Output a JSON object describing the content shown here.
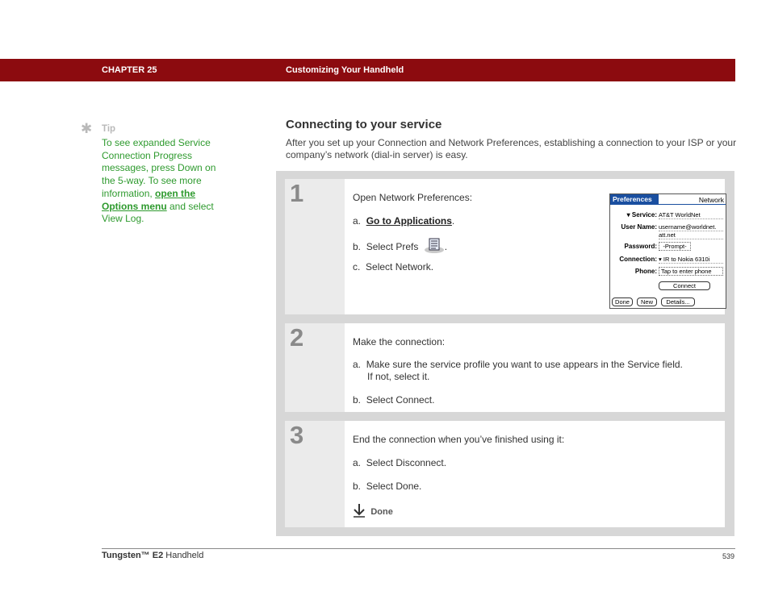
{
  "header": {
    "chapter": "CHAPTER 25",
    "title": "Customizing Your Handheld",
    "color": "#8c0b0f"
  },
  "tip": {
    "icon": "asterisk-icon",
    "label": "Tip",
    "text_before": "To see expanded Service Connection Progress messages, press Down on the 5-way. To see more information, ",
    "link": "open the Options menu",
    "text_after": " and select View Log.",
    "color": "#2e9a2e"
  },
  "section": {
    "title": "Connecting to your service",
    "intro": "After you set up your Connection and Network Preferences, establishing a connection to your ISP or your company’s network (dial-in server) is easy."
  },
  "steps": [
    {
      "number": "1",
      "lead": "Open Network Preferences:",
      "a_prefix": "a.",
      "a_link": "Go to Applications",
      "a_suffix": ".",
      "b_prefix": "b.",
      "b_text": "Select Prefs",
      "b_suffix": ".",
      "c_prefix": "c.",
      "c_text": "Select Network."
    },
    {
      "number": "2",
      "lead": "Make the connection:",
      "a_prefix": "a.",
      "a_text_1": "Make sure the service profile you want to use appears in the Service field.",
      "a_text_2": "If not, select it.",
      "b_prefix": "b.",
      "b_text": "Select Connect."
    },
    {
      "number": "3",
      "lead": "End the connection when you’ve finished using it:",
      "a_prefix": "a.",
      "a_text": "Select Disconnect.",
      "b_prefix": "b.",
      "b_text": "Select Done.",
      "done_icon": "down-arrow-icon",
      "done_label": "Done"
    }
  ],
  "palm_screen": {
    "tab": "Preferences",
    "app": "Network",
    "service_label": "Service:",
    "service_value": "AT&T WorldNet",
    "username_label": "User Name:",
    "username_value_1": "username@worldnet.",
    "username_value_2": "att.net",
    "password_label": "Password:",
    "password_value": "-Prompt-",
    "connection_label": "Connection:",
    "connection_value": "IR to Nokia 6310i",
    "phone_label": "Phone:",
    "phone_value": "Tap to enter phone",
    "connect_button": "Connect",
    "done_button": "Done",
    "new_button": "New",
    "details_button": "Details..."
  },
  "footer": {
    "product": "Tungsten™ E2",
    "product_suffix": " Handheld",
    "page": "539"
  }
}
